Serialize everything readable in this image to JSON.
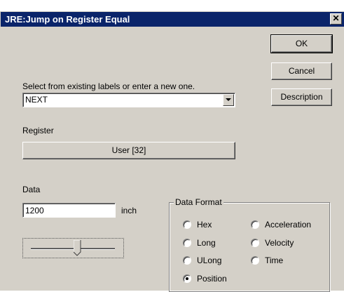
{
  "window": {
    "title": "JRE:Jump on Register Equal",
    "close_glyph": "✕"
  },
  "buttons": {
    "ok": "OK",
    "cancel": "Cancel",
    "description": "Description"
  },
  "label_select": {
    "prompt": "Select from existing labels or enter a new one.",
    "value": "NEXT"
  },
  "register": {
    "label": "Register",
    "value": "User [32]"
  },
  "data": {
    "label": "Data",
    "value": "1200",
    "unit": "inch",
    "slider_level": 0.55
  },
  "data_format": {
    "legend": "Data Format",
    "options": [
      "Hex",
      "Long",
      "ULong",
      "Position",
      "Acceleration",
      "Velocity",
      "Time"
    ],
    "selected": "Position"
  }
}
